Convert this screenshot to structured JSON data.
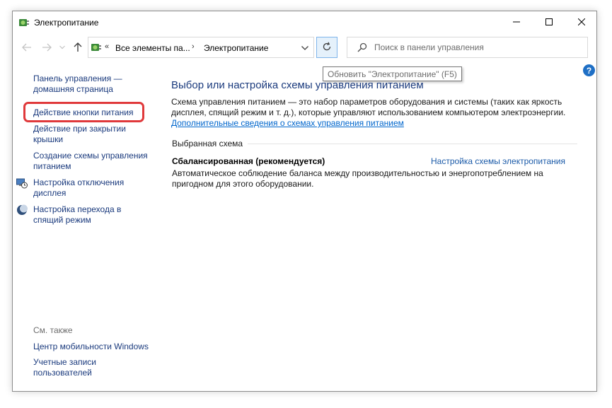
{
  "window": {
    "title": "Электропитание",
    "icons": {
      "app": "power-options-icon",
      "minimize": "minimize-icon",
      "maximize": "maximize-icon",
      "close": "close-icon"
    }
  },
  "navbar": {
    "back_icon": "arrow-left-icon",
    "forward_icon": "arrow-right-icon",
    "up_icon": "arrow-up-icon",
    "address": {
      "overflow": "«",
      "crumbs": [
        "Все элементы па...",
        "Электропитание"
      ],
      "separator": "›",
      "dropdown_icon": "chevron-down-icon"
    },
    "refresh_icon": "refresh-icon",
    "refresh_tooltip": "Обновить \"Электропитание\" (F5)",
    "search": {
      "placeholder": "Поиск в панели управления",
      "icon": "search-icon"
    }
  },
  "help_icon": "help-icon",
  "sidebar": {
    "home": "Панель управления — домашняя страница",
    "links": [
      "Действие кнопки питания",
      "Действие при закрытии крышки",
      "Создание схемы управления питанием",
      "Настройка отключения дисплея",
      "Настройка перехода в спящий режим"
    ],
    "icons": {
      "display": "monitor-clock-icon",
      "sleep": "moon-icon"
    },
    "see_also_label": "См. также",
    "see_also": [
      "Центр мобильности Windows",
      "Учетные записи пользователей"
    ],
    "highlight_color": "#e0393b"
  },
  "main": {
    "title": "Выбор или настройка схемы управления питанием",
    "description": "Схема управления питанием — это набор параметров оборудования и системы (таких как яркость дисплея, спящий режим и т. д.), которые управляют использованием компьютером электроэнергии.",
    "more_link": "Дополнительные сведения о схемах управления питанием",
    "section_label": "Выбранная схема",
    "plan": {
      "name": "Сбалансированная (рекомендуется)",
      "settings_link": "Настройка схемы электропитания",
      "description": "Автоматическое соблюдение баланса между производительностью и энергопотреблением на пригодном для этого оборудовании."
    }
  },
  "colors": {
    "link": "#1a3a7d",
    "hyperlink": "#0066cc",
    "accent_border": "#7eb4ea",
    "help": "#1f6fc5"
  }
}
